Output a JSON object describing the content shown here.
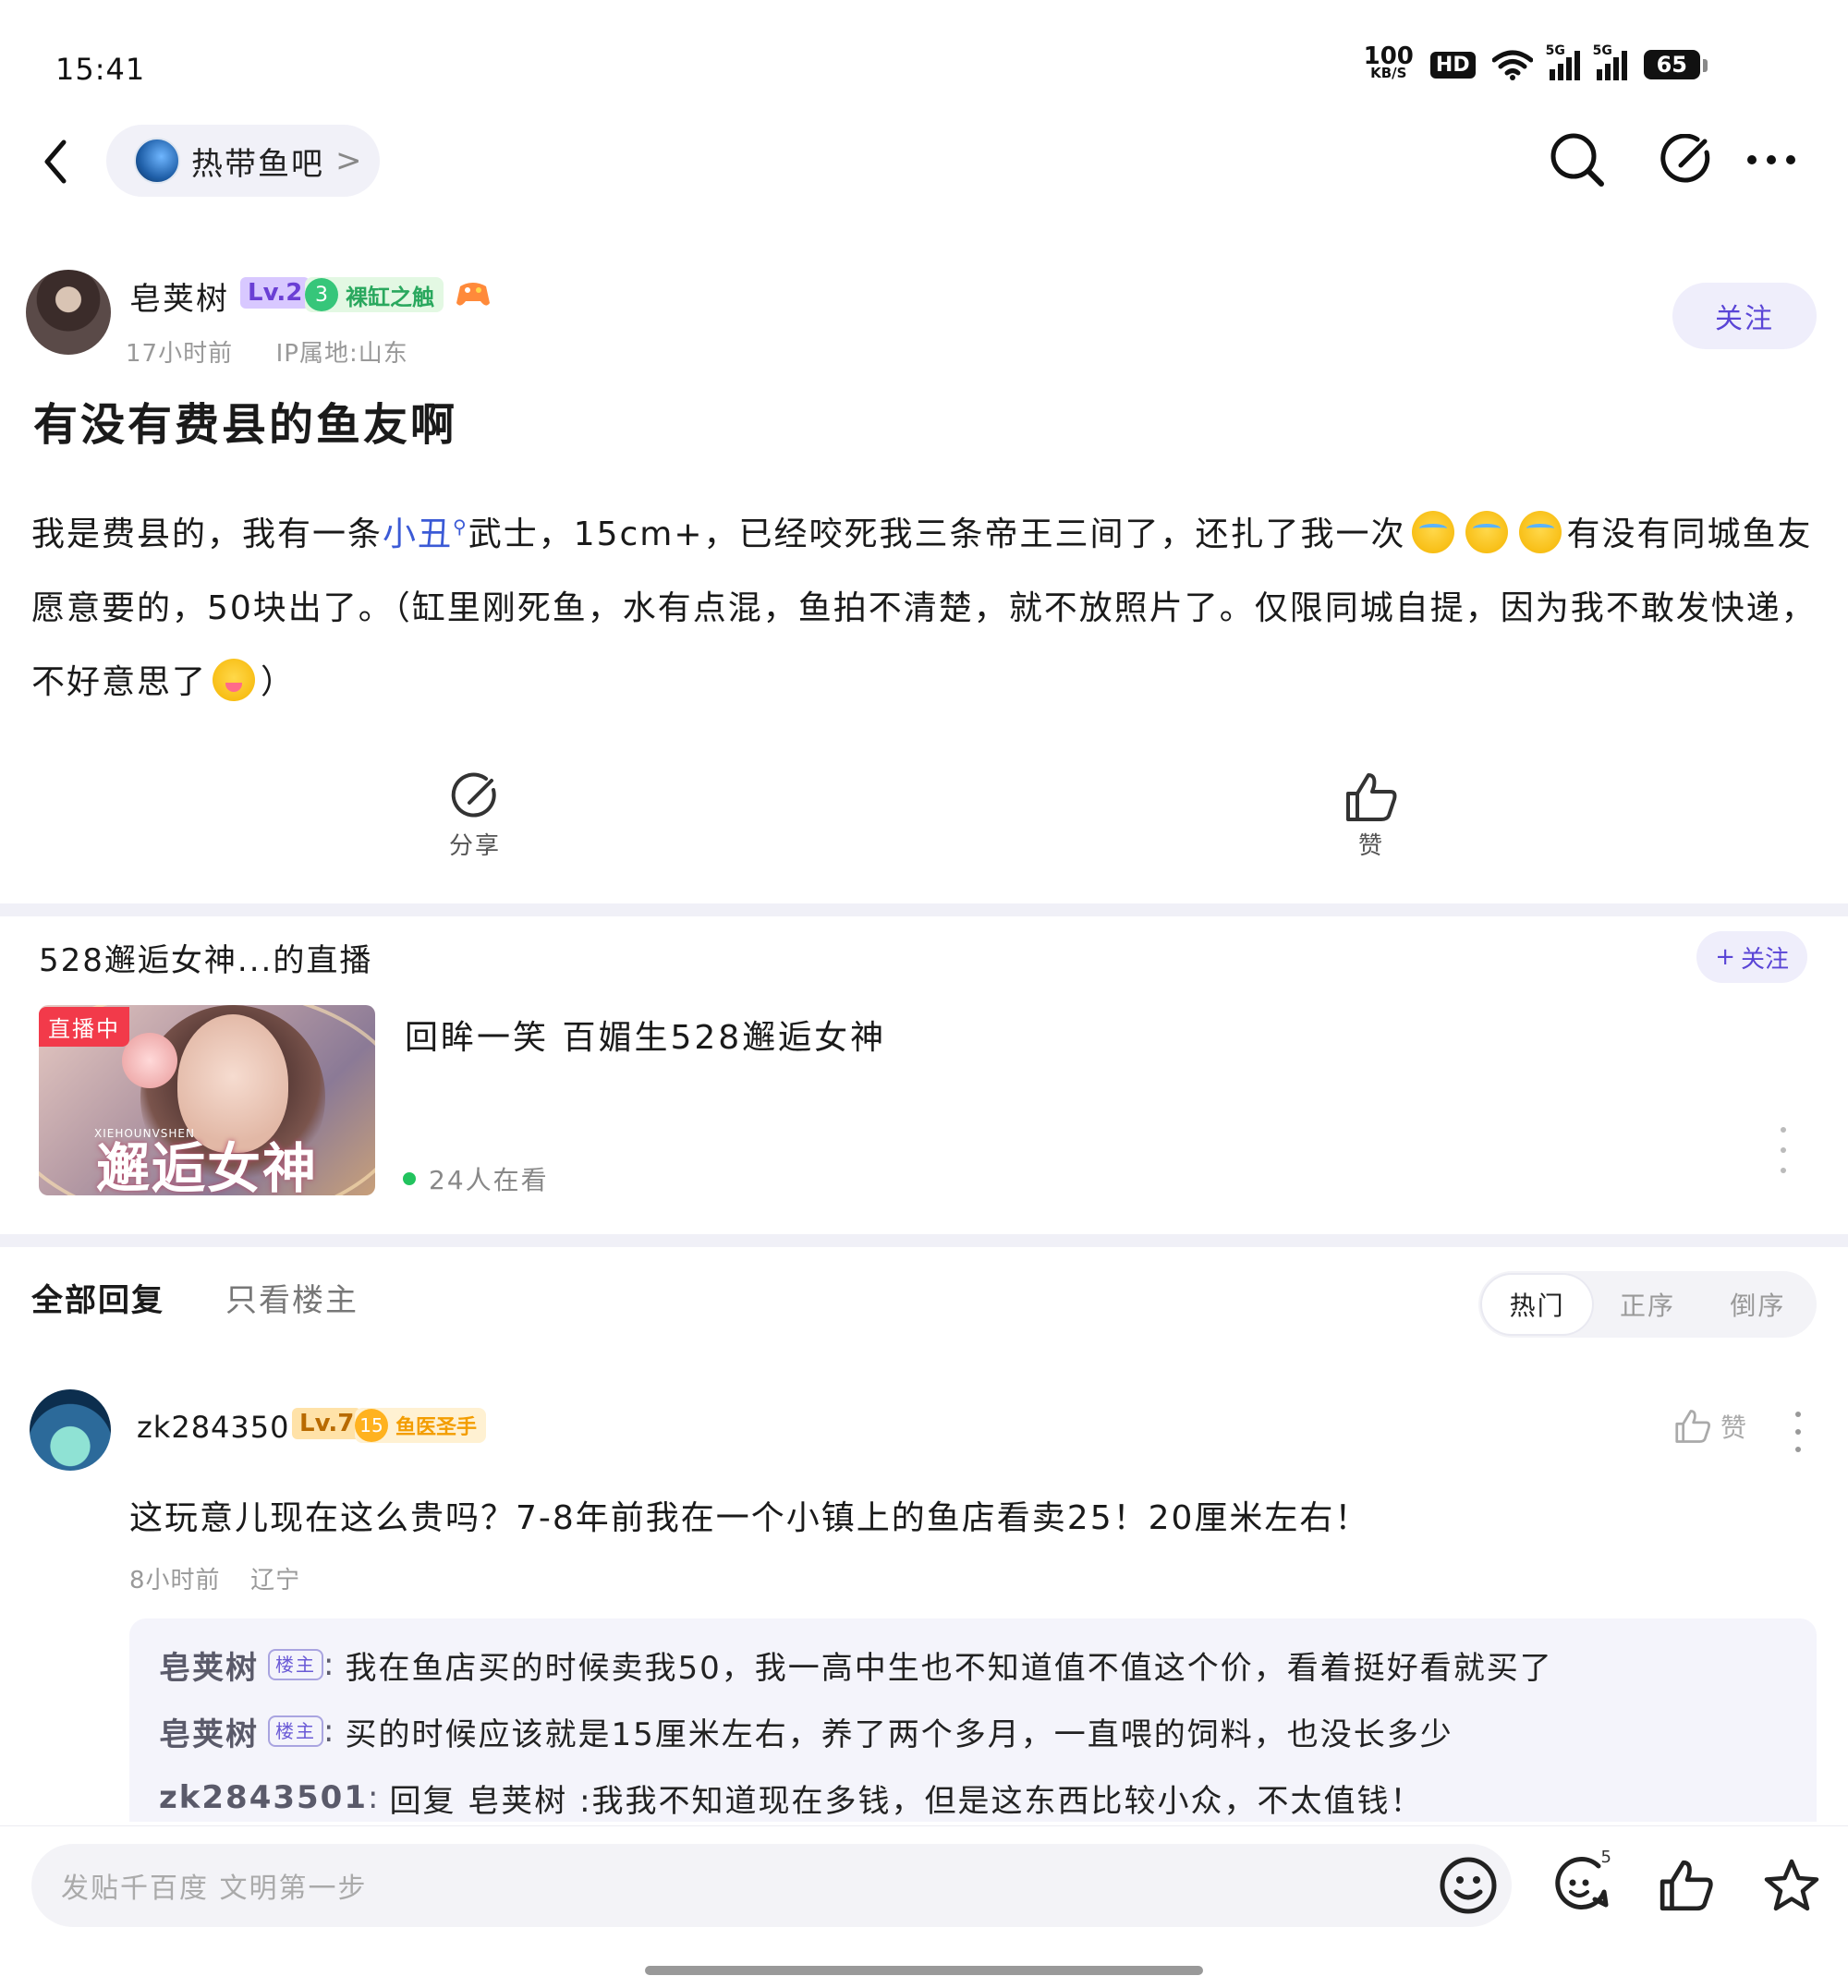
{
  "status_bar": {
    "time": "15:41",
    "net_speed_value": "100",
    "net_speed_unit": "KB/S",
    "hd": "HD",
    "signal_1": "5G",
    "signal_2": "5G",
    "battery": "65"
  },
  "header": {
    "forum_name": "热带鱼吧",
    "forum_chevron": ">"
  },
  "post": {
    "author": {
      "name": "皂荚树",
      "level": "Lv.2",
      "title_level": "3",
      "title_name": "裸缸之触",
      "time": "17小时前",
      "ip_location": "IP属地:山东"
    },
    "follow_label": "关注",
    "title": "有没有费县的鱼友啊",
    "body_part1": "我是费县的，我有一条",
    "body_link": "小丑",
    "body_part2": "武士，15cm+，已经咬死我三条帝王三间了，还扎了我一次",
    "body_part3": "有没有同城鱼友愿意要的，50块出了。（缸里刚死鱼，水有点混，鱼拍不清楚，就不放照片了。仅限同城自提，因为我不敢发快递，不好意思了",
    "body_part4": "）",
    "share_label": "分享",
    "like_label": "赞"
  },
  "live": {
    "header": "528邂逅女神...的直播",
    "follow_label": "关注",
    "follow_plus": "+",
    "badge": "直播中",
    "thumb_text": "邂逅女神",
    "thumb_small_text": "XIEHOUNVSHEN",
    "title": "回眸一笑 百媚生528邂逅女神",
    "viewers": "24人在看"
  },
  "replies": {
    "tab_all": "全部回复",
    "tab_op_only": "只看楼主",
    "sort_options": [
      "热门",
      "正序",
      "倒序"
    ]
  },
  "comment": {
    "username": "zk2843501",
    "level": "Lv.7",
    "title_level": "15",
    "title_name": "鱼医圣手",
    "like_label": "赞",
    "text": "这玩意儿现在这么贵吗？7-8年前我在一个小镇上的鱼店看卖25！20厘米左右！",
    "time": "8小时前",
    "location": "辽宁",
    "subreplies": [
      {
        "name": "皂荚树",
        "tag": "楼主",
        "text": "我在鱼店买的时候卖我50，我一高中生也不知道值不值这个价，看着挺好看就买了"
      },
      {
        "name": "皂荚树",
        "tag": "楼主",
        "text": "买的时候应该就是15厘米左右，养了两个多月，一直喂的饲料，也没长多少"
      },
      {
        "name": "zk2843501",
        "tag": "",
        "text": "回复 皂荚树 :我我不知道现在多钱，但是这东西比较小众，不太值钱！"
      }
    ]
  },
  "bottom_bar": {
    "input_placeholder": "发贴千百度 文明第一步",
    "reply_count": "5"
  }
}
